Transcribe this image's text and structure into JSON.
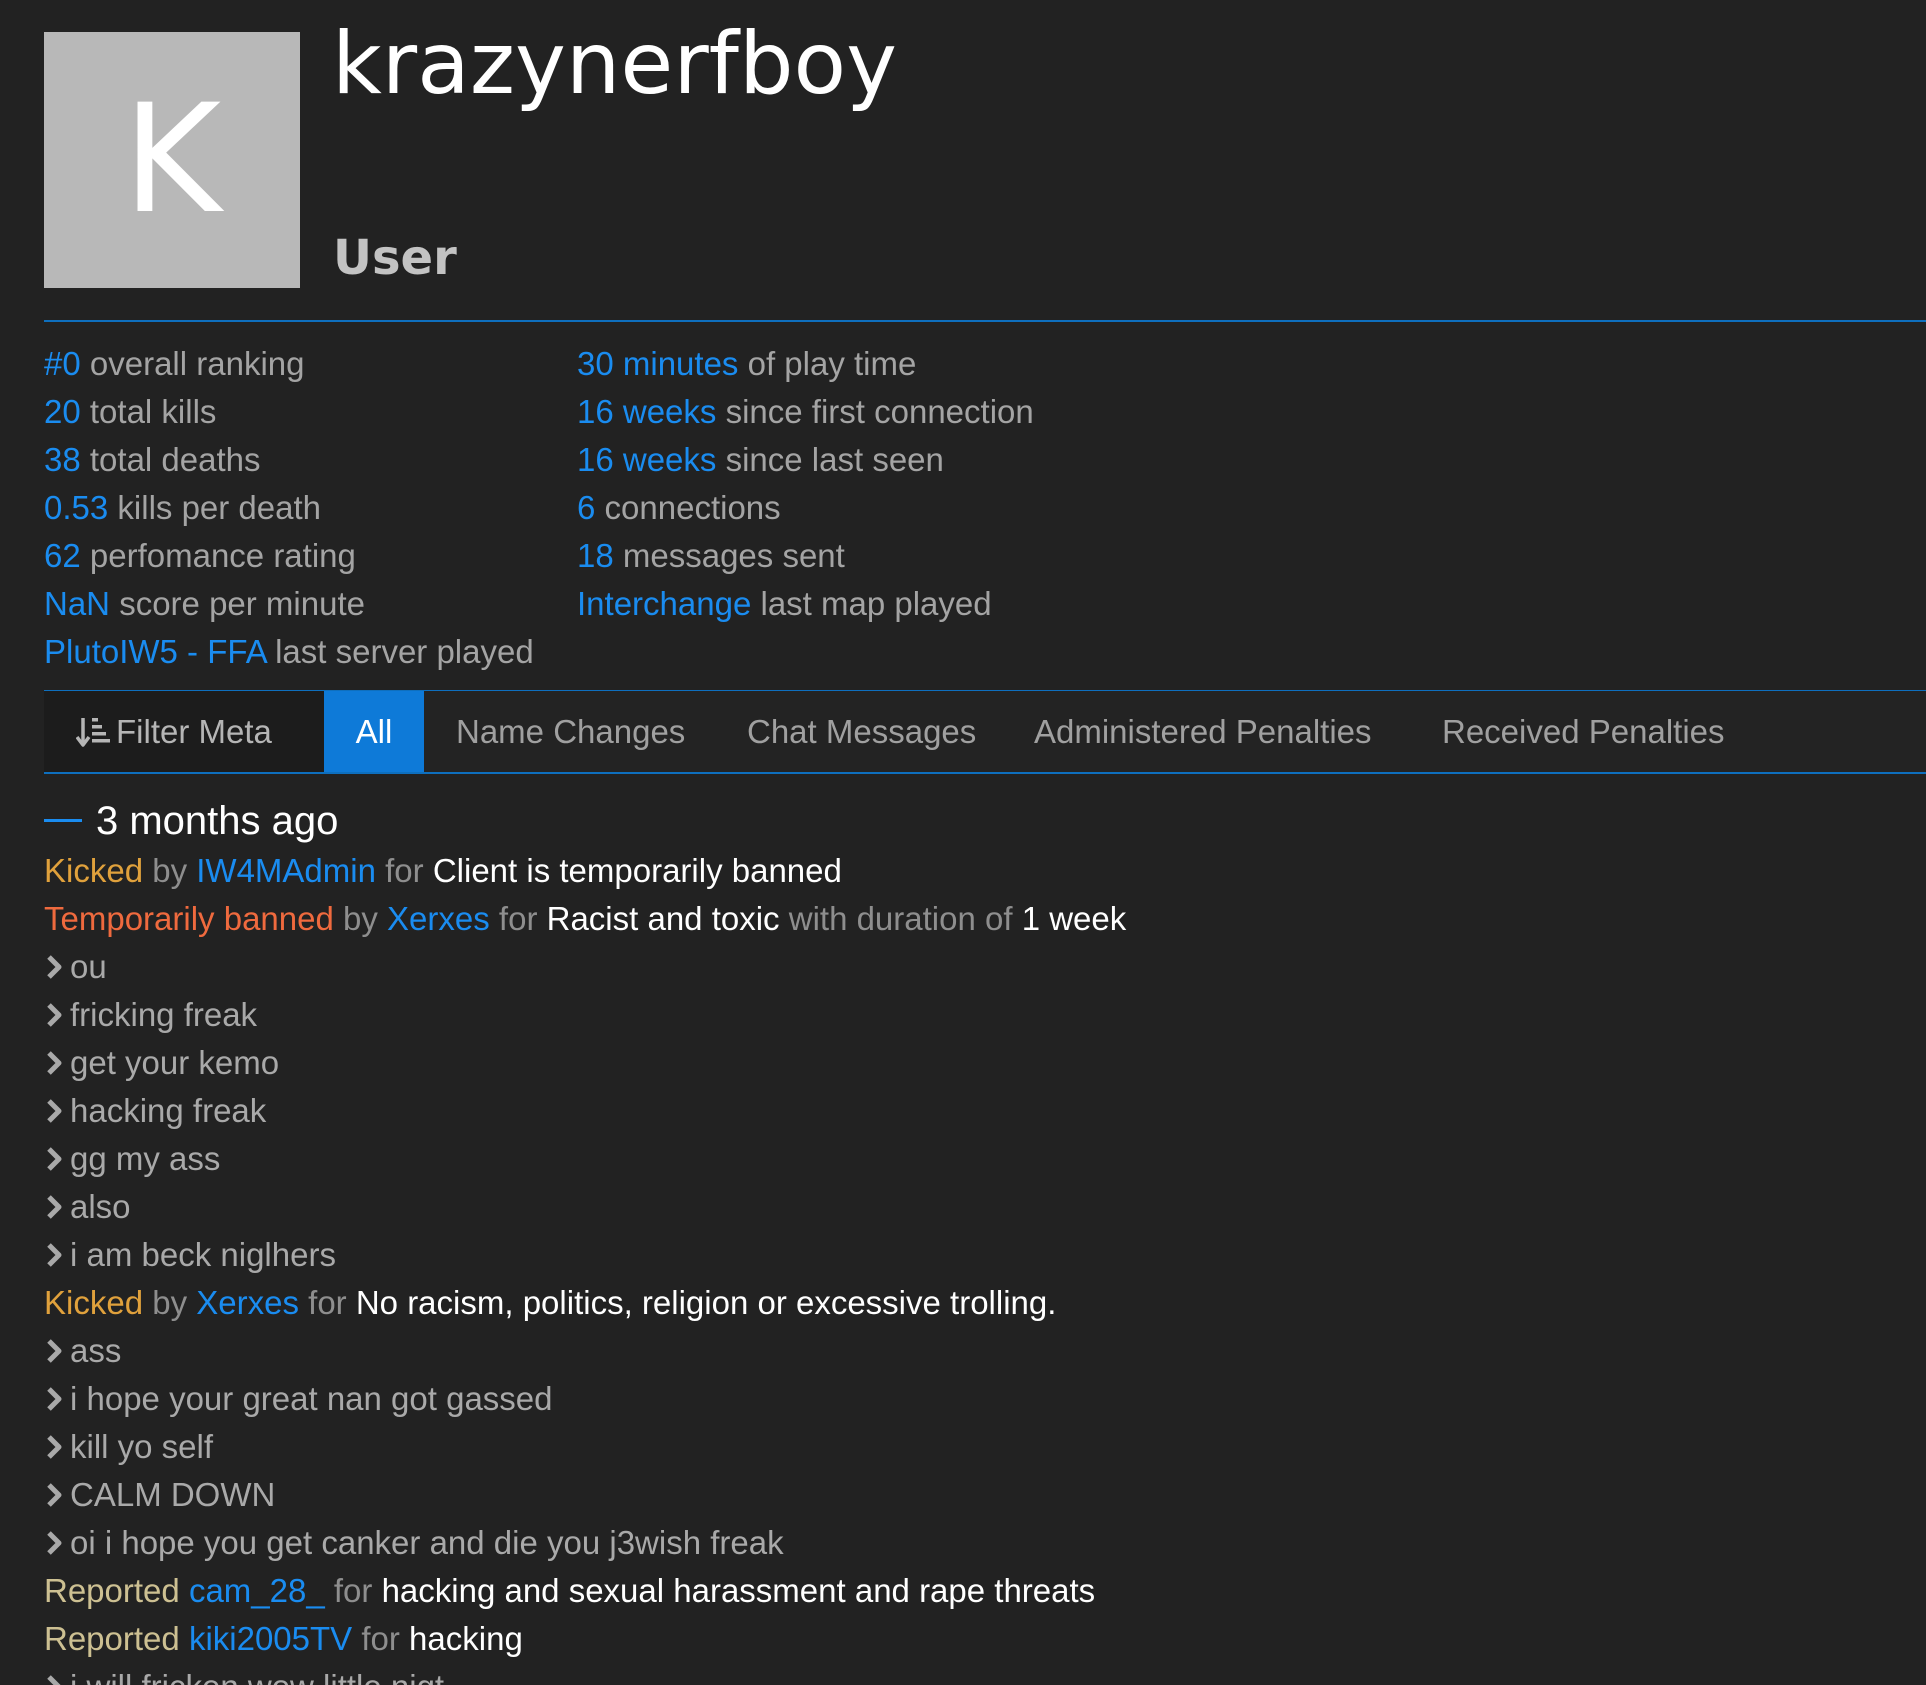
{
  "profile": {
    "avatar_letter": "K",
    "username": "krazynerfboy",
    "level": "User"
  },
  "stats_left": [
    {
      "value": "#0",
      "label": " overall ranking"
    },
    {
      "value": "20",
      "label": " total kills"
    },
    {
      "value": "38",
      "label": " total deaths"
    },
    {
      "value": "0.53",
      "label": " kills per death"
    },
    {
      "value": "62",
      "label": " perfomance rating"
    },
    {
      "value": "NaN",
      "label": " score per minute"
    },
    {
      "value": "PlutoIW5 - FFA",
      "label": " last server played"
    }
  ],
  "stats_right": [
    {
      "value": "30 minutes",
      "label": " of play time"
    },
    {
      "value": "16 weeks",
      "label": " since first connection"
    },
    {
      "value": "16 weeks",
      "label": " since last seen"
    },
    {
      "value": "6",
      "label": " connections"
    },
    {
      "value": "18",
      "label": " messages sent"
    },
    {
      "value": "Interchange",
      "label": " last map played"
    }
  ],
  "tabs": {
    "filter": "Filter Meta",
    "all": "All",
    "name_changes": "Name Changes",
    "chat_messages": "Chat Messages",
    "administered_penalties": "Administered Penalties",
    "received_penalties": "Received Penalties"
  },
  "feed": {
    "date_heading": "3 months ago",
    "penalties": [
      {
        "type": "Kicked",
        "by": " by ",
        "origin": "IW4MAdmin",
        "for": " for ",
        "reason": "Client is temporarily banned"
      },
      {
        "type": "Temporarily banned",
        "by": " by ",
        "origin": "Xerxes",
        "for": " for ",
        "reason": "Racist and toxic",
        "duration_prefix": " with duration of ",
        "duration": "1 week"
      },
      {
        "type": "Kicked",
        "by": " by ",
        "origin": "Xerxes",
        "for": " for ",
        "reason": "No racism, politics, religion or excessive trolling."
      }
    ],
    "reports": [
      {
        "type": "Reported",
        "target": "cam_28_",
        "for": " for ",
        "reason": "hacking and sexual harassment and rape threats"
      },
      {
        "type": "Reported",
        "target": "kiki2005TV",
        "for": " for ",
        "reason": "hacking"
      }
    ],
    "messages_a": [
      "ou",
      "fricking freak",
      "get your kemo",
      "hacking freak",
      "gg my ass",
      "also",
      "i am beck niglhers"
    ],
    "messages_b": [
      "ass",
      "i hope your great nan got gassed",
      "kill yo self",
      "CALM DOWN",
      "oi i hope you get canker and die you j3wish freak"
    ],
    "messages_c": [
      "i will fricken wow little nigt"
    ]
  },
  "colors": {
    "accent": "#1a8cf0",
    "kicked": "#e0a13c",
    "banned": "#ef6a3e",
    "reported": "#cdc092",
    "background": "#222222"
  },
  "icons": {
    "filter": "sort-filter-icon",
    "message": "chevron-right-icon"
  }
}
